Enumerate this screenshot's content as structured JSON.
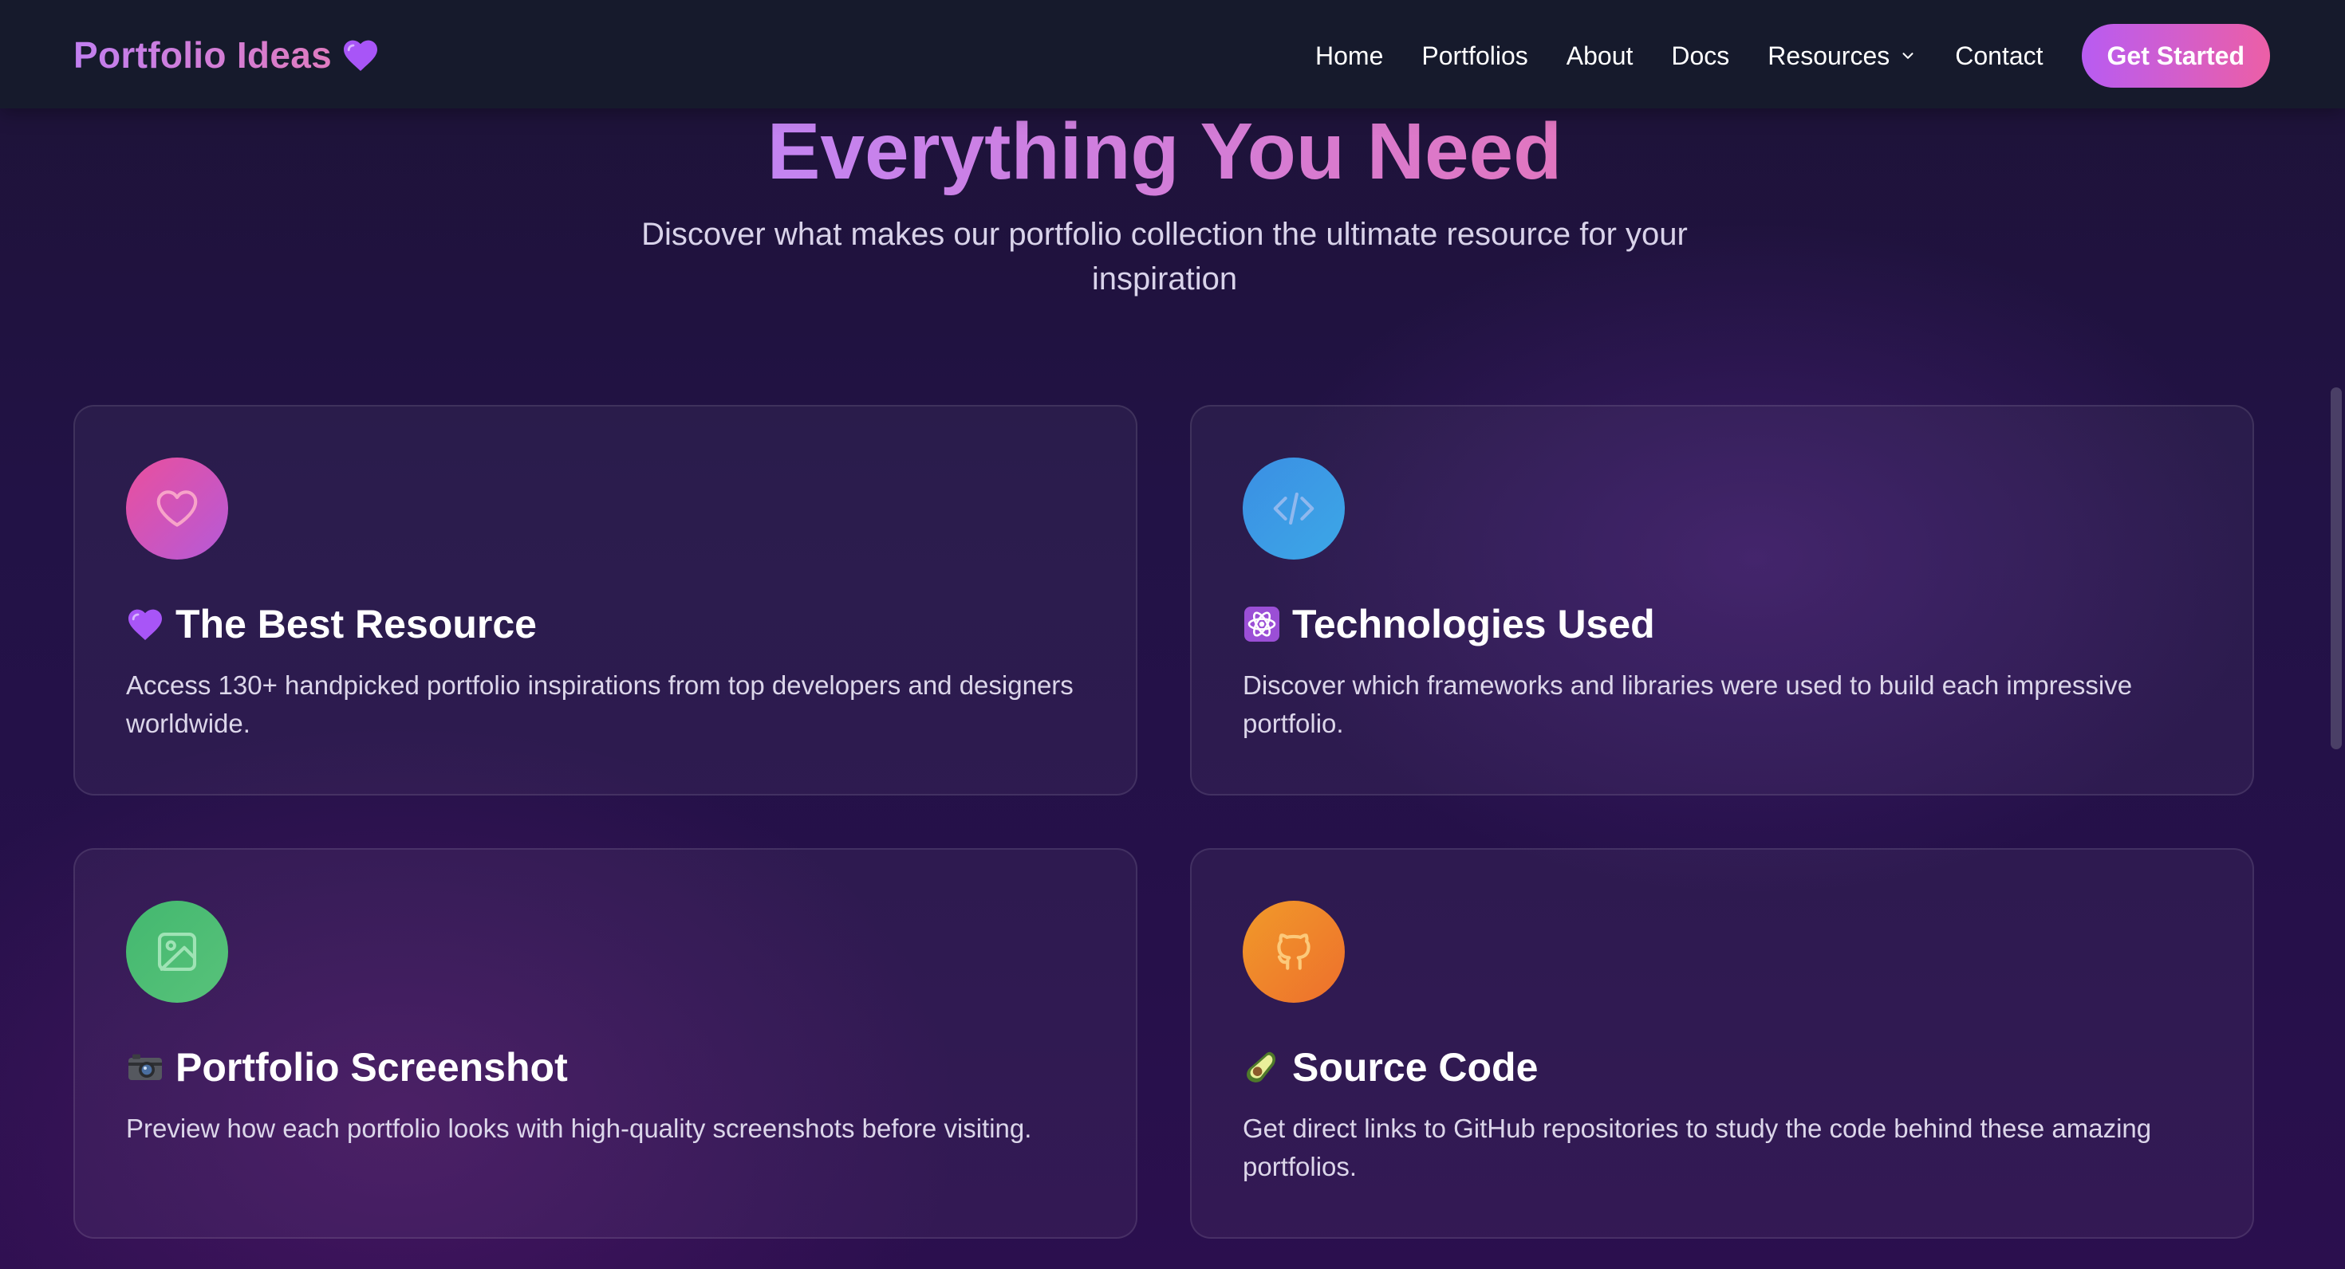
{
  "brand": {
    "name": "Portfolio Ideas",
    "emoji": "purple-heart-emoji"
  },
  "nav": {
    "links": [
      "Home",
      "Portfolios",
      "About",
      "Docs",
      "Resources",
      "Contact"
    ],
    "cta_label": "Get Started"
  },
  "section": {
    "title": "Everything You Need",
    "subtitle": "Discover what makes our portfolio collection the ultimate resource for your inspiration"
  },
  "cards": [
    {
      "icon": "heart-icon",
      "emoji": "purple-heart-emoji",
      "title": "The Best Resource",
      "description": "Access 130+ handpicked portfolio inspirations from top developers and designers worldwide."
    },
    {
      "icon": "code-icon",
      "emoji": "atom-symbol-emoji",
      "title": "Technologies Used",
      "description": "Discover which frameworks and libraries were used to build each impressive portfolio."
    },
    {
      "icon": "image-icon",
      "emoji": "camera-emoji",
      "title": "Portfolio Screenshot",
      "description": "Preview how each portfolio looks with high-quality screenshots before visiting."
    },
    {
      "icon": "github-icon",
      "emoji": "avocado-emoji",
      "title": "Source Code",
      "description": "Get direct links to GitHub repositories to study the code behind these amazing portfolios."
    }
  ],
  "colors": {
    "accent_gradient_start": "#b85cf2",
    "accent_gradient_end": "#ec5fa6",
    "navbar_bg": "#161a2c",
    "page_bg": "#221246"
  }
}
